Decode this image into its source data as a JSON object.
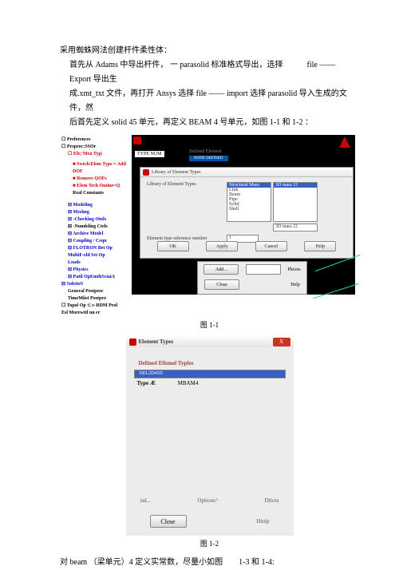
{
  "doc": {
    "heading": "采用蜘蛛网法创建杆件柔性体：",
    "para1_a": "首先从 Adams 中导出杆件， ",
    "para1_b": " parasolid 标准格式导出，选择",
    "para1_c": "file —— Export 导出生",
    "para2": "成.xmt_txt 文件，再打开 Ansys 选择 file —— import 选择 parasolid 导入生成的文件，然",
    "para3": "后首先定义 solid 45 单元，再定义 BEAM 4 号单元，如图 1-1 和 1-2 ：",
    "caption1": "图 1-1",
    "caption2": "图 1-2",
    "bottom_a": "对 beam （梁单元）4 定义实常数，尽量小如图",
    "bottom_b": "1-3 和 1-4:"
  },
  "tree": {
    "t0": "☐ Preferences",
    "t1": "☐ Preproc:SSOr",
    "t2": "☐ Ele;'Men Typ|",
    "t3": "■ Swtch\\Elem Type = Add",
    "t4": "DOF",
    "t5": "■ Remove QOFs",
    "t6": "■ Elem Tech Outine=Q",
    "t7": "Real Constants",
    "t8": "⊟ Modeling",
    "t9": "⊟ Meshng",
    "t10": "⊟ -Checking Otols",
    "t11": "⊟ -Numleling Ctels",
    "t12": "⊟ Archive Model",
    "t13": "⊟ Coupling / Ceqn",
    "t14": "⊟ FLOTRON Bet Op",
    "t15": "MultiF-eld Set Op",
    "t16": "Loads",
    "t17": "⊟ Physics",
    "t18": "⊟ Patil OpEmthSciaiA",
    "t19": "⊟ SoletteS",
    "t20": "General Postproc",
    "t21": "TimeMiist Postpro",
    "t22": "☐ Topol Op ⊂ ▹ RDM Prol",
    "t23": "Esl Morewttl un er"
  },
  "fig1": {
    "type_num": "TYPE NUM",
    "def_elem": "Defined Element",
    "none_def": "NONE DEFINED",
    "lib_title": "Library of Element Types",
    "lib_label": "Library of Element Types",
    "list1": {
      "i0": "Structural Mass",
      "i1": "Link",
      "i2": "Beam",
      "i3": "Pipe",
      "i4": "Solid",
      "i5": "Shell"
    },
    "list2_sel": "3D mass      21",
    "list2_sub": "3D mass      21",
    "ref_label": "Element type reference number",
    "ref_value": "1",
    "btn_ok": "OK",
    "btn_apply": "Apply",
    "btn_cancel": "Cancel",
    "btn_help": "Help",
    "sub_add": "Add...",
    "sub_pkions": "Pkions",
    "sub_close": "Close",
    "sub_help": "Help"
  },
  "fig2": {
    "title": "Element Types",
    "close_x": "X",
    "def_label": "Defined Efismel Typfes",
    "sel_text": "DEL2D45D",
    "type_row_a": "Type   Æ",
    "type_row_b": "MBAM4",
    "b_lbl1": "isd...",
    "b_lbl2": "Options^",
    "b_lbl3": "Dtlces",
    "close_btn": "Close",
    "help_txt": "Htolp"
  }
}
